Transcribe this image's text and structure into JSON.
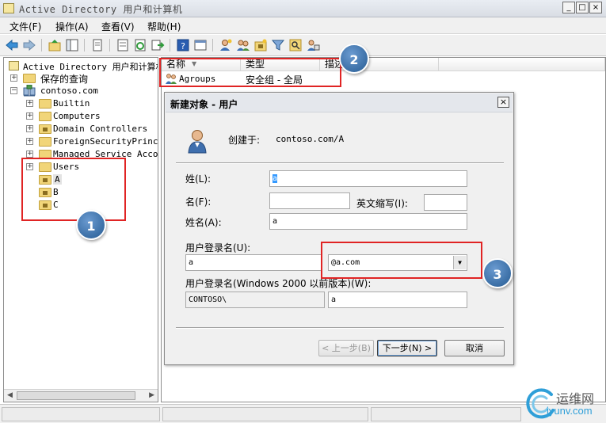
{
  "window": {
    "title": "Active Directory 用户和计算机",
    "minimize": "_",
    "maximize": "□",
    "close": "×"
  },
  "menu": [
    "文件(F)",
    "操作(A)",
    "查看(V)",
    "帮助(H)"
  ],
  "toolbar_icons": [
    "back-icon",
    "forward-icon",
    "up-folder-icon",
    "show-tree-icon",
    "copy-icon",
    "properties-icon",
    "refresh-icon",
    "export-icon",
    "help-icon",
    "console-tree-icon",
    "new-user-icon",
    "new-group-icon",
    "new-ou-icon",
    "filter-icon",
    "find-icon",
    "delegate-icon"
  ],
  "tree": {
    "root": "Active Directory 用户和计算机",
    "saved_queries": "保存的查询",
    "domain": "contoso.com",
    "items": [
      "Builtin",
      "Computers",
      "Domain Controllers",
      "ForeignSecurityPrincip",
      "Managed Service Accour",
      "Users",
      "A",
      "B",
      "C"
    ]
  },
  "list": {
    "columns": [
      "名称",
      "类型",
      "描述"
    ],
    "rows": [
      {
        "name": "Agroups",
        "type": "安全组 - 全局"
      }
    ]
  },
  "dialog": {
    "title": "新建对象 - 用户",
    "created_in_label": "创建于:",
    "created_in_value": "contoso.com/A",
    "last_name_label": "姓(L):",
    "last_name_value": "a",
    "first_name_label": "名(F):",
    "first_name_value": "",
    "initials_label": "英文缩写(I):",
    "initials_value": "",
    "full_name_label": "姓名(A):",
    "full_name_value": "a",
    "logon_name_label": "用户登录名(U):",
    "logon_name_value": "a",
    "upn_suffix_value": "@a.com",
    "pre2000_label": "用户登录名(Windows 2000 以前版本)(W):",
    "pre2000_domain_value": "CONTOSO\\",
    "pre2000_name_value": "a",
    "back_button": "< 上一步(B)",
    "next_button": "下一步(N) >",
    "cancel_button": "取消"
  },
  "callouts": [
    "1",
    "2",
    "3"
  ],
  "watermark": {
    "brand_cn": "运维网",
    "brand_url": "iyunv.com"
  },
  "colors": {
    "callout_blue": "#3a6ea5",
    "annotation_red": "#e02424",
    "selection_blue": "#3399ff"
  }
}
